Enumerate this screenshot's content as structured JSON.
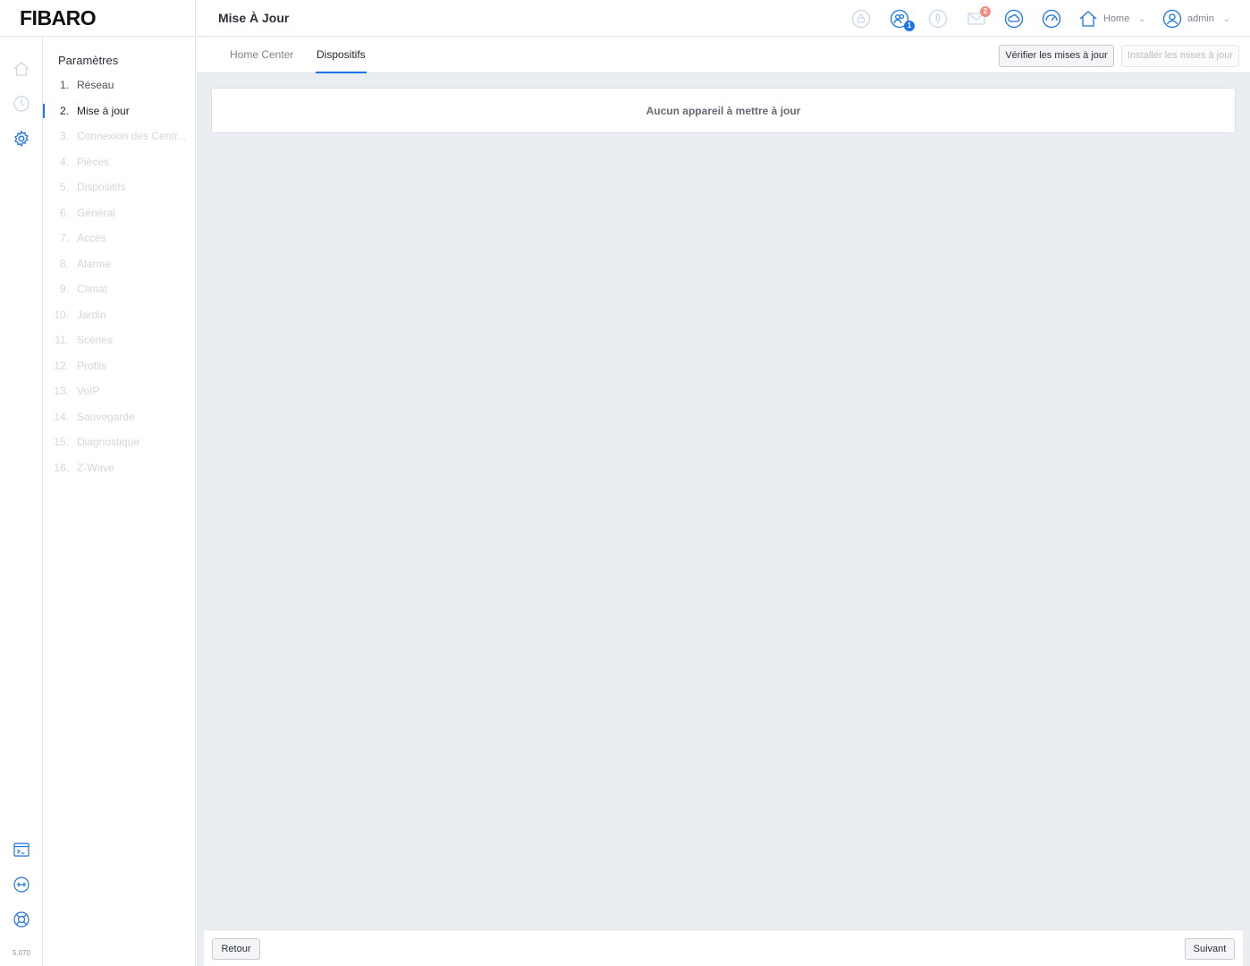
{
  "brand": {
    "logo": "FIBARO"
  },
  "header": {
    "title": "Mise À Jour",
    "icons": [
      {
        "name": "lock-user-icon",
        "color": "#c9d7ec"
      },
      {
        "name": "users-icon",
        "color": "#1a73e8",
        "badge": "1"
      },
      {
        "name": "microphone-icon",
        "color": "#c9d7ec"
      },
      {
        "name": "mail-icon",
        "color": "#c9d7ec",
        "badge": "2"
      },
      {
        "name": "weather-icon",
        "color": "#1a73e8"
      },
      {
        "name": "gauge-icon",
        "color": "#1a73e8"
      }
    ],
    "home_label": "Home",
    "user_label": "admin"
  },
  "rail": {
    "icons": [
      "house-icon",
      "clock-icon",
      "gear-icon",
      "terminal-icon",
      "connection-icon",
      "support-icon"
    ],
    "version": "5.070"
  },
  "settings": {
    "title": "Paramètres",
    "items": [
      {
        "num": "1.",
        "label": "Réseau",
        "state": "done"
      },
      {
        "num": "2.",
        "label": "Mise à jour",
        "state": "active"
      },
      {
        "num": "3.",
        "label": "Connexion des Centr...",
        "state": "pending"
      },
      {
        "num": "4.",
        "label": "Pièces",
        "state": "pending"
      },
      {
        "num": "5.",
        "label": "Dispositifs",
        "state": "pending"
      },
      {
        "num": "6.",
        "label": "Général",
        "state": "pending"
      },
      {
        "num": "7.",
        "label": "Accès",
        "state": "pending"
      },
      {
        "num": "8.",
        "label": "Alarme",
        "state": "pending"
      },
      {
        "num": "9.",
        "label": "Climat",
        "state": "pending"
      },
      {
        "num": "10.",
        "label": "Jardin",
        "state": "pending"
      },
      {
        "num": "11.",
        "label": "Scènes",
        "state": "pending"
      },
      {
        "num": "12.",
        "label": "Profils",
        "state": "pending"
      },
      {
        "num": "13.",
        "label": "VoIP",
        "state": "pending"
      },
      {
        "num": "14.",
        "label": "Sauvegarde",
        "state": "pending"
      },
      {
        "num": "15.",
        "label": "Diagnostique",
        "state": "pending"
      },
      {
        "num": "16.",
        "label": "Z-Wave",
        "state": "pending"
      }
    ]
  },
  "main": {
    "tabs": [
      {
        "label": "Home Center",
        "active": false
      },
      {
        "label": "Dispositifs",
        "active": true
      }
    ],
    "check_button": "Vérifier les mises à jour",
    "install_button": "Installer les mises à jour",
    "empty_message": "Aucun appareil à mettre à jour"
  },
  "footer": {
    "back_label": "Retour",
    "next_label": "Suivant"
  },
  "colors": {
    "accent": "#1a73e8",
    "badge_blue": "#1a73e8",
    "badge_red": "#f28b82"
  }
}
